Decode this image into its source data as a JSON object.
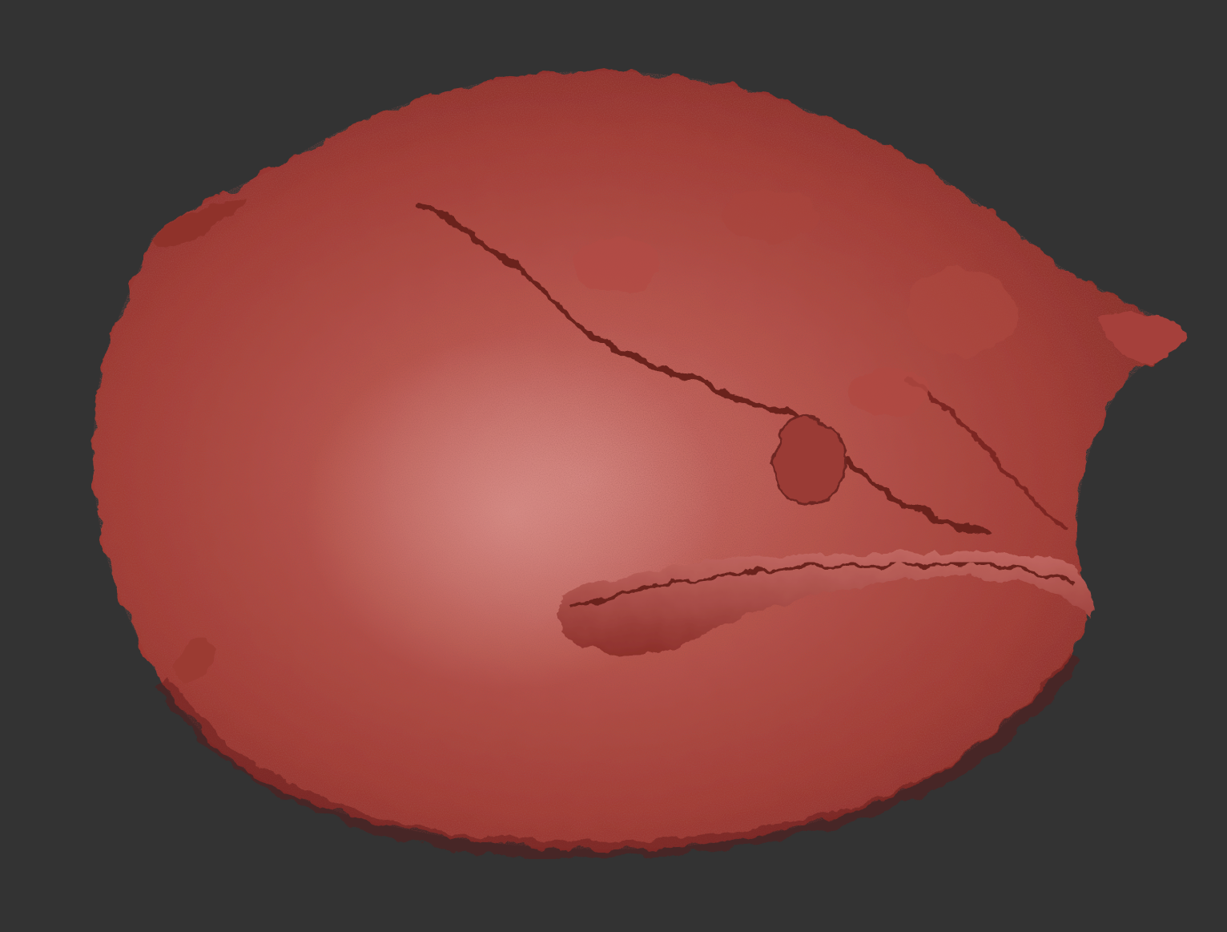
{
  "viewport": {
    "background_color": "#333333"
  },
  "model": {
    "subject": "sculpted-rock-mesh",
    "material_color": "#b64a42",
    "highlight_color": "#d08680",
    "shadow_color": "#6e2320"
  }
}
